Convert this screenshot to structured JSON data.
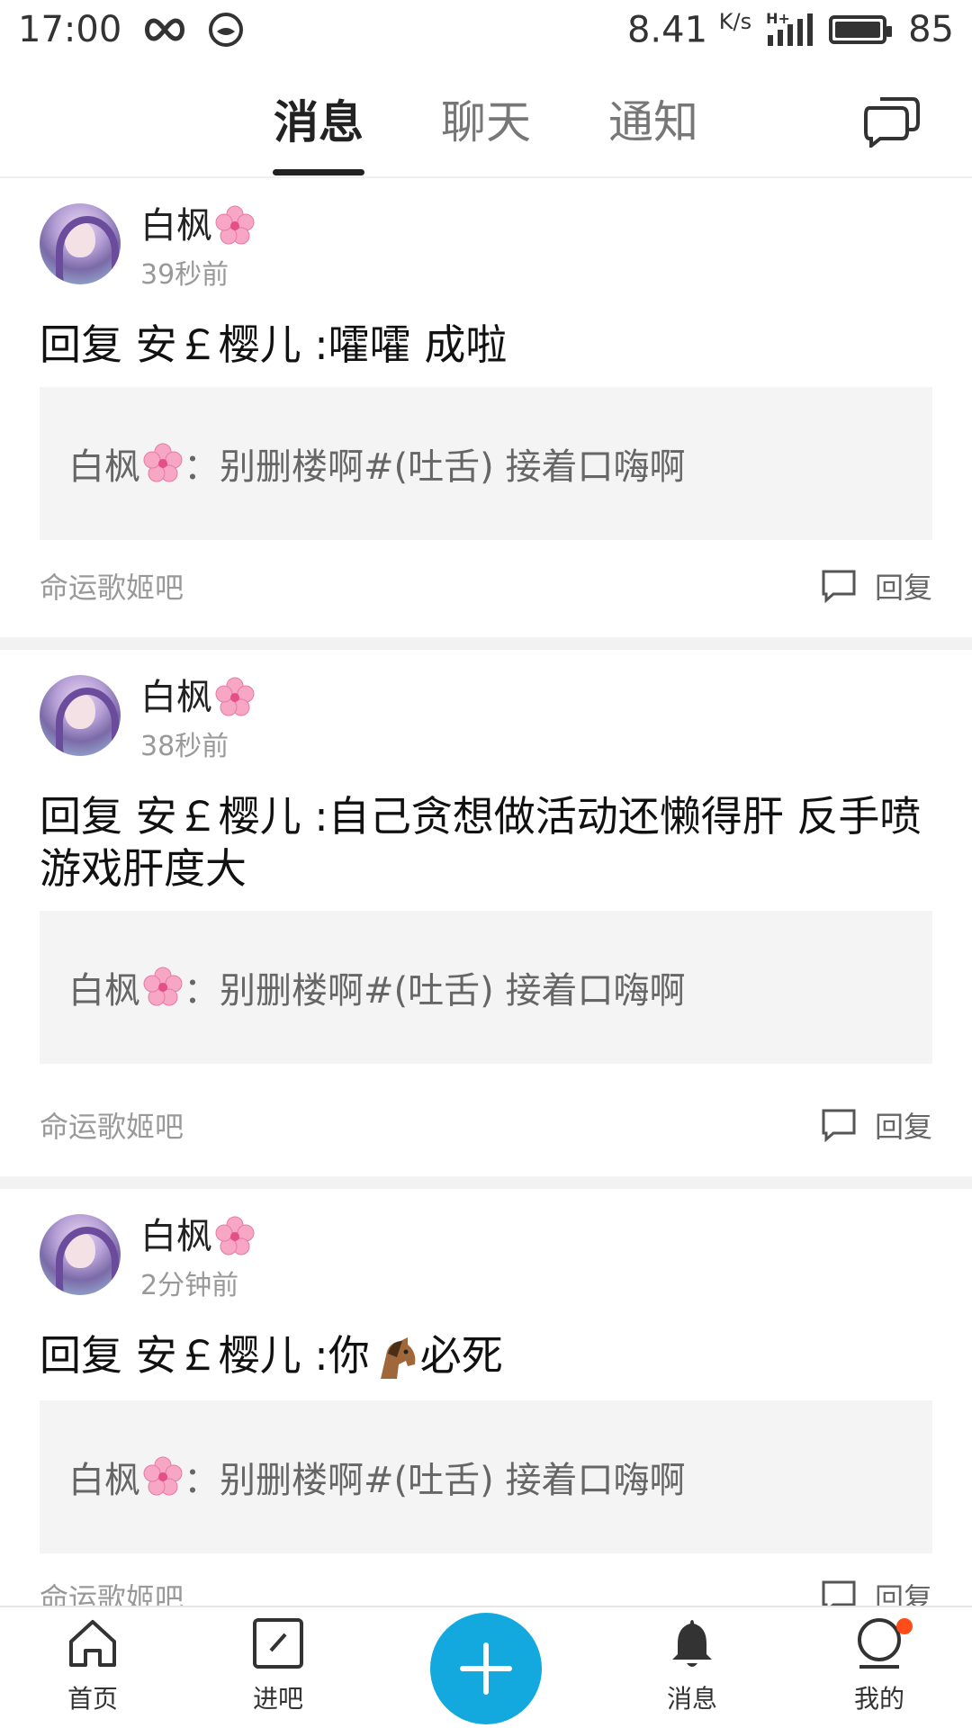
{
  "status_bar": {
    "time": "17:00",
    "speed": "8.41",
    "speed_unit": "K/s",
    "network": "H+",
    "battery": "85"
  },
  "tabs": [
    {
      "label": "消息",
      "active": true
    },
    {
      "label": "聊天",
      "active": false
    },
    {
      "label": "通知",
      "active": false
    }
  ],
  "feed": [
    {
      "user": "白枫",
      "time": "39秒前",
      "reply_text": "回复 安￡樱儿 :嚯嚯 成啦",
      "quote_user": "白枫",
      "quote_text": "：别删楼啊#(吐舌) 接着口嗨啊",
      "forum": "命运歌姬吧",
      "reply_label": "回复"
    },
    {
      "user": "白枫",
      "time": "38秒前",
      "reply_text": "回复 安￡樱儿 :自己贪想做活动还懒得肝 反手喷游戏肝度大",
      "quote_user": "白枫",
      "quote_text": "：别删楼啊#(吐舌) 接着口嗨啊",
      "forum": "命运歌姬吧",
      "reply_label": "回复"
    },
    {
      "user": "白枫",
      "time": "2分钟前",
      "reply_prefix": "回复 安￡樱儿 :你",
      "reply_suffix": "必死",
      "quote_user": "白枫",
      "quote_text": "：别删楼啊#(吐舌) 接着口嗨啊",
      "forum": "命运歌姬吧",
      "reply_label": "回复"
    }
  ],
  "bottom_nav": {
    "home": "首页",
    "forums": "进吧",
    "messages": "消息",
    "me": "我的"
  },
  "colors": {
    "accent": "#13a9de",
    "badge": "#ff4d1a"
  }
}
